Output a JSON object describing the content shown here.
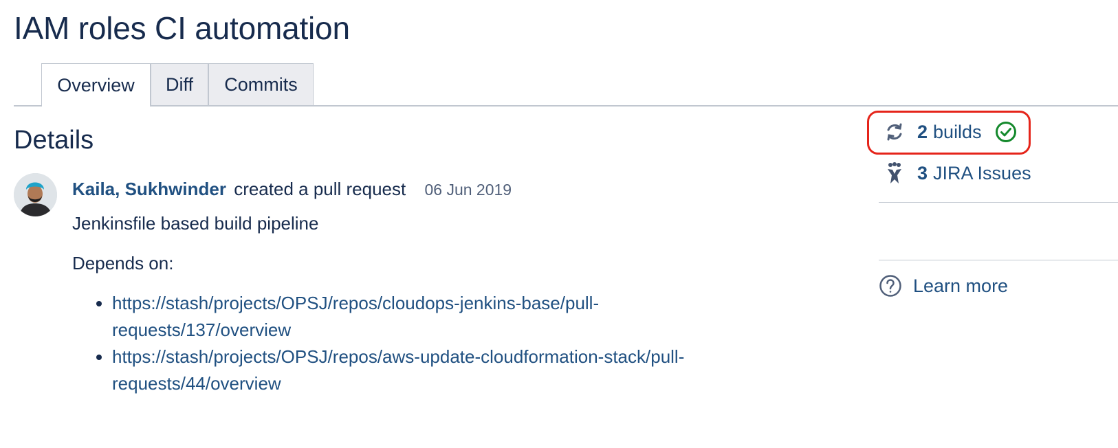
{
  "page": {
    "title": "IAM roles CI automation"
  },
  "tabs": [
    {
      "label": "Overview",
      "active": true
    },
    {
      "label": "Diff",
      "active": false
    },
    {
      "label": "Commits",
      "active": false
    }
  ],
  "details": {
    "title": "Details",
    "activity": {
      "author": "Kaila, Sukhwinder",
      "action": "created a pull request",
      "date": "06 Jun 2019",
      "description": "Jenkinsfile based build pipeline",
      "depends_label": "Depends on:",
      "links": [
        "https://stash/projects/OPSJ/repos/cloudops-jenkins-base/pull-requests/137/overview",
        "https://stash/projects/OPSJ/repos/aws-update-cloudformation-stack/pull-requests/44/overview"
      ]
    }
  },
  "sidebar": {
    "builds": {
      "count": "2",
      "label": "builds",
      "icon": "sync-icon",
      "status_icon": "check-circle-icon",
      "status_color": "#14892c"
    },
    "jira": {
      "count": "3",
      "label": "JIRA Issues",
      "icon": "jira-icon"
    },
    "learn_more": {
      "label": "Learn more",
      "icon": "help-icon"
    }
  },
  "colors": {
    "link": "#205081",
    "highlight": "#e5241a",
    "text": "#172b4d"
  }
}
